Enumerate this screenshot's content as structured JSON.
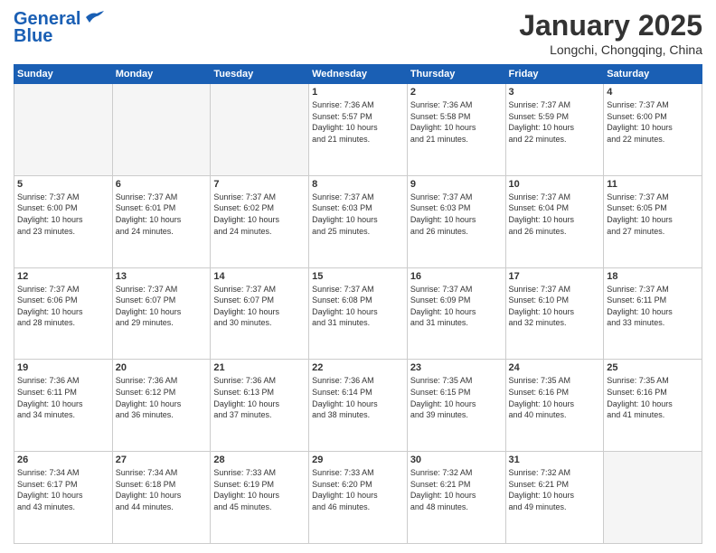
{
  "header": {
    "logo_line1": "General",
    "logo_line2": "Blue",
    "month_title": "January 2025",
    "location": "Longchi, Chongqing, China"
  },
  "days_of_week": [
    "Sunday",
    "Monday",
    "Tuesday",
    "Wednesday",
    "Thursday",
    "Friday",
    "Saturday"
  ],
  "weeks": [
    [
      {
        "day": "",
        "info": ""
      },
      {
        "day": "",
        "info": ""
      },
      {
        "day": "",
        "info": ""
      },
      {
        "day": "1",
        "info": "Sunrise: 7:36 AM\nSunset: 5:57 PM\nDaylight: 10 hours\nand 21 minutes."
      },
      {
        "day": "2",
        "info": "Sunrise: 7:36 AM\nSunset: 5:58 PM\nDaylight: 10 hours\nand 21 minutes."
      },
      {
        "day": "3",
        "info": "Sunrise: 7:37 AM\nSunset: 5:59 PM\nDaylight: 10 hours\nand 22 minutes."
      },
      {
        "day": "4",
        "info": "Sunrise: 7:37 AM\nSunset: 6:00 PM\nDaylight: 10 hours\nand 22 minutes."
      }
    ],
    [
      {
        "day": "5",
        "info": "Sunrise: 7:37 AM\nSunset: 6:00 PM\nDaylight: 10 hours\nand 23 minutes."
      },
      {
        "day": "6",
        "info": "Sunrise: 7:37 AM\nSunset: 6:01 PM\nDaylight: 10 hours\nand 24 minutes."
      },
      {
        "day": "7",
        "info": "Sunrise: 7:37 AM\nSunset: 6:02 PM\nDaylight: 10 hours\nand 24 minutes."
      },
      {
        "day": "8",
        "info": "Sunrise: 7:37 AM\nSunset: 6:03 PM\nDaylight: 10 hours\nand 25 minutes."
      },
      {
        "day": "9",
        "info": "Sunrise: 7:37 AM\nSunset: 6:03 PM\nDaylight: 10 hours\nand 26 minutes."
      },
      {
        "day": "10",
        "info": "Sunrise: 7:37 AM\nSunset: 6:04 PM\nDaylight: 10 hours\nand 26 minutes."
      },
      {
        "day": "11",
        "info": "Sunrise: 7:37 AM\nSunset: 6:05 PM\nDaylight: 10 hours\nand 27 minutes."
      }
    ],
    [
      {
        "day": "12",
        "info": "Sunrise: 7:37 AM\nSunset: 6:06 PM\nDaylight: 10 hours\nand 28 minutes."
      },
      {
        "day": "13",
        "info": "Sunrise: 7:37 AM\nSunset: 6:07 PM\nDaylight: 10 hours\nand 29 minutes."
      },
      {
        "day": "14",
        "info": "Sunrise: 7:37 AM\nSunset: 6:07 PM\nDaylight: 10 hours\nand 30 minutes."
      },
      {
        "day": "15",
        "info": "Sunrise: 7:37 AM\nSunset: 6:08 PM\nDaylight: 10 hours\nand 31 minutes."
      },
      {
        "day": "16",
        "info": "Sunrise: 7:37 AM\nSunset: 6:09 PM\nDaylight: 10 hours\nand 31 minutes."
      },
      {
        "day": "17",
        "info": "Sunrise: 7:37 AM\nSunset: 6:10 PM\nDaylight: 10 hours\nand 32 minutes."
      },
      {
        "day": "18",
        "info": "Sunrise: 7:37 AM\nSunset: 6:11 PM\nDaylight: 10 hours\nand 33 minutes."
      }
    ],
    [
      {
        "day": "19",
        "info": "Sunrise: 7:36 AM\nSunset: 6:11 PM\nDaylight: 10 hours\nand 34 minutes."
      },
      {
        "day": "20",
        "info": "Sunrise: 7:36 AM\nSunset: 6:12 PM\nDaylight: 10 hours\nand 36 minutes."
      },
      {
        "day": "21",
        "info": "Sunrise: 7:36 AM\nSunset: 6:13 PM\nDaylight: 10 hours\nand 37 minutes."
      },
      {
        "day": "22",
        "info": "Sunrise: 7:36 AM\nSunset: 6:14 PM\nDaylight: 10 hours\nand 38 minutes."
      },
      {
        "day": "23",
        "info": "Sunrise: 7:35 AM\nSunset: 6:15 PM\nDaylight: 10 hours\nand 39 minutes."
      },
      {
        "day": "24",
        "info": "Sunrise: 7:35 AM\nSunset: 6:16 PM\nDaylight: 10 hours\nand 40 minutes."
      },
      {
        "day": "25",
        "info": "Sunrise: 7:35 AM\nSunset: 6:16 PM\nDaylight: 10 hours\nand 41 minutes."
      }
    ],
    [
      {
        "day": "26",
        "info": "Sunrise: 7:34 AM\nSunset: 6:17 PM\nDaylight: 10 hours\nand 43 minutes."
      },
      {
        "day": "27",
        "info": "Sunrise: 7:34 AM\nSunset: 6:18 PM\nDaylight: 10 hours\nand 44 minutes."
      },
      {
        "day": "28",
        "info": "Sunrise: 7:33 AM\nSunset: 6:19 PM\nDaylight: 10 hours\nand 45 minutes."
      },
      {
        "day": "29",
        "info": "Sunrise: 7:33 AM\nSunset: 6:20 PM\nDaylight: 10 hours\nand 46 minutes."
      },
      {
        "day": "30",
        "info": "Sunrise: 7:32 AM\nSunset: 6:21 PM\nDaylight: 10 hours\nand 48 minutes."
      },
      {
        "day": "31",
        "info": "Sunrise: 7:32 AM\nSunset: 6:21 PM\nDaylight: 10 hours\nand 49 minutes."
      },
      {
        "day": "",
        "info": ""
      }
    ]
  ]
}
